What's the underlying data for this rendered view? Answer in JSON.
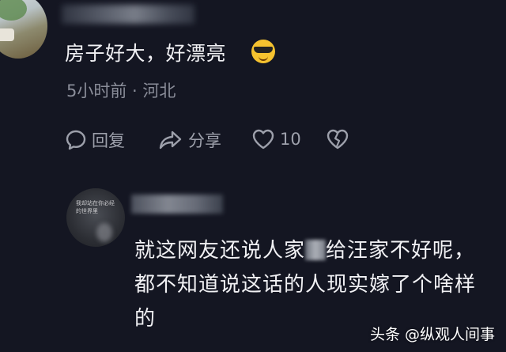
{
  "comment": {
    "text": "房子好大，好漂亮",
    "emoji_icon": "sunglasses-emoji-icon",
    "meta": "5小时前 · 河北",
    "actions": {
      "reply_label": "回复",
      "share_label": "分享",
      "like_count": "10"
    }
  },
  "reply": {
    "line1_part1": "就这网友还说人家",
    "line1_part2": "给汪家不好呢，",
    "line2": "都不知道说这话的人现实嫁了个啥样",
    "line3": "的",
    "avatar_text": "我却站在你必经的世界里"
  },
  "watermark": "头条 @纵观人间事",
  "colors": {
    "background": "#141622",
    "text_primary": "#f1f1f4",
    "text_secondary": "#8a8d99",
    "icon": "#9da0ab"
  }
}
